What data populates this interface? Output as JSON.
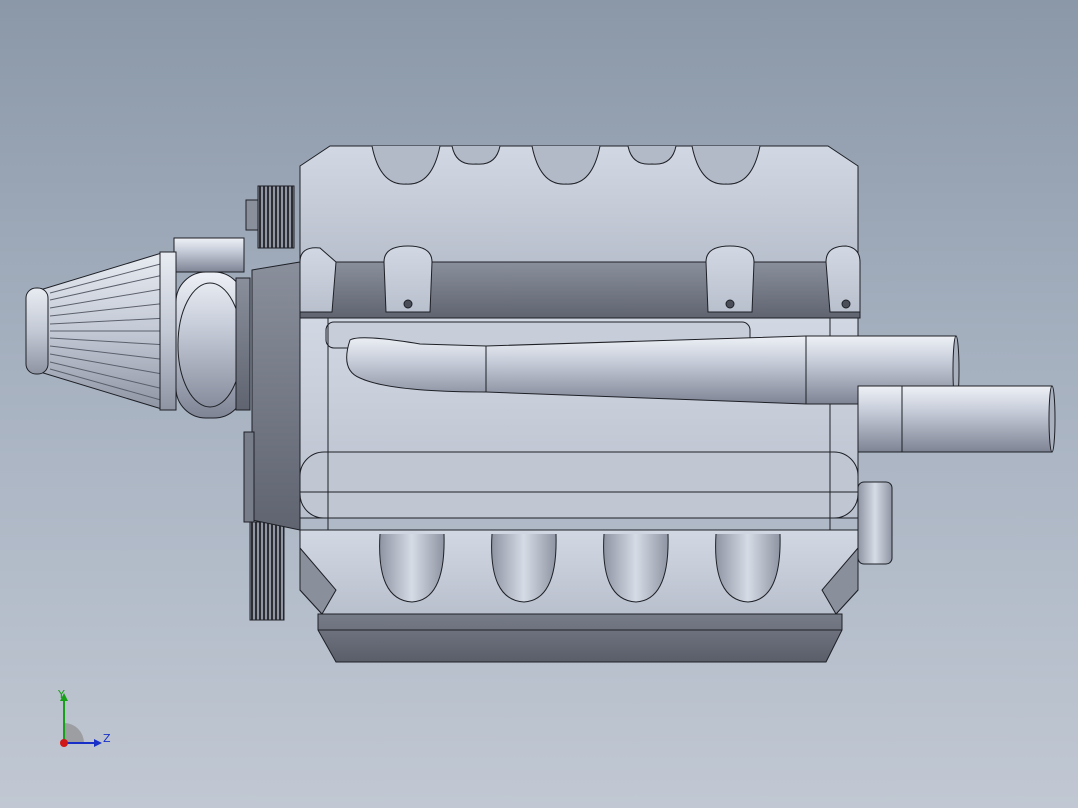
{
  "viewport": {
    "background_top": "#8b98a8",
    "background_bottom": "#c1c8d3"
  },
  "model": {
    "description_icon": "engine-3d-model",
    "body_color": "#c4cbd8",
    "shadow_color": "#6f7482",
    "edge_color": "#1e2026"
  },
  "triad": {
    "y_label": "Y",
    "z_label": "Z",
    "y_color": "#18a018",
    "z_color": "#1830c8",
    "x_color": "#d01818"
  }
}
